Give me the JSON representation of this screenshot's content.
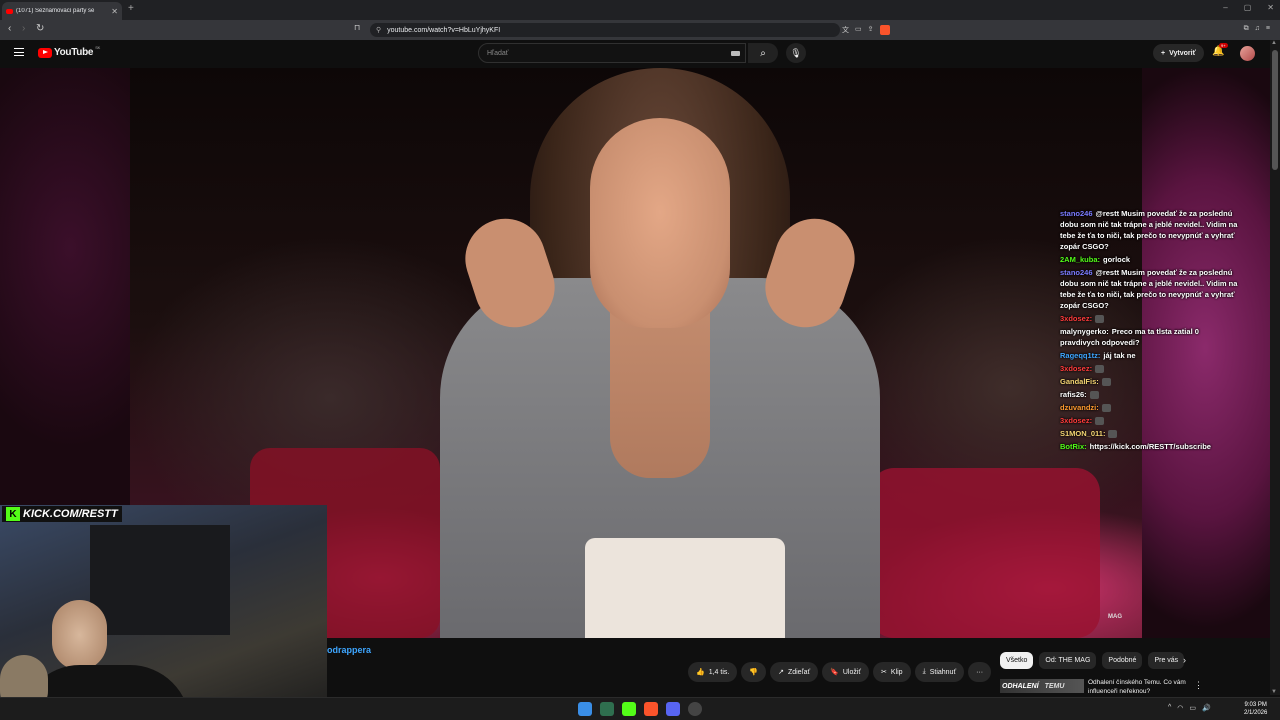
{
  "browser": {
    "tab_title": "(1071) Seznamovací party se",
    "url": "youtube.com/watch?v=HbLuYjhyKFI",
    "new_tab": "+",
    "window_controls": [
      "–",
      "▢",
      "✕"
    ]
  },
  "youtube": {
    "logo_text": "YouTube",
    "country": "SK",
    "search_placeholder": "Hľadať",
    "create_label": "Vytvoriť",
    "notification_count": "9+"
  },
  "overlay": {
    "kick_text": "KICK.COM/RESTT",
    "watermark": "MAG"
  },
  "chat": [
    {
      "user": "stano246",
      "user_color": "#7b7bff",
      "text": "@restt Musim povedať že za poslednú dobu som nič tak trápne a jeblé nevidel.. Vidim na tebe že ťa to niči, tak prečo to nevypnúť a vyhrať zopár CSGO?"
    },
    {
      "user": "2AM_kuba:",
      "user_color": "#53fc18",
      "text": "gorlock"
    },
    {
      "user": "stano246",
      "user_color": "#7b7bff",
      "text": "@restt Musim povedať že za poslednú dobu som nič tak trápne a jeblé nevidel.. Vidim na tebe že ťa to niči, tak prečo to nevypnúť a vyhrať zopár CSGO?"
    },
    {
      "user": "3xdosez:",
      "user_color": "#ff3b3b",
      "text": ""
    },
    {
      "user": "malynygerko:",
      "user_color": "#ffffff",
      "text": "Preco ma ta tlsta zatial 0 pravdivych odpovedi?"
    },
    {
      "user": "Rageqq1tz:",
      "user_color": "#3ea6ff",
      "text": "jáj tak ne"
    },
    {
      "user": "3xdosez:",
      "user_color": "#ff3b3b",
      "text": ""
    },
    {
      "user": "GandalFis:",
      "user_color": "#f7d774",
      "text": ""
    },
    {
      "user": "rafis26:",
      "user_color": "#ffffff",
      "text": ""
    },
    {
      "user": "dzuvandzi:",
      "user_color": "#ff9b2f",
      "text": ""
    },
    {
      "user": "3xdosez:",
      "user_color": "#ff3b3b",
      "text": ""
    },
    {
      "user": "S1MON_011:",
      "user_color": "#f7d774",
      "text": ""
    },
    {
      "user": "BotRix:",
      "user_color": "#53fc18",
      "text": "https://kick.com/RESTT/subscribe"
    }
  ],
  "below_video": {
    "channel_fragment": "odrappera",
    "like_count": "1,4 tis.",
    "share": "Zdieľať",
    "save": "Uložiť",
    "clip": "Klip",
    "download": "Stiahnuť",
    "more": "···"
  },
  "chips": [
    "Všetko",
    "Od: THE MAG",
    "Podobné",
    "Pre vás"
  ],
  "recommendation": {
    "thumb_text_left": "ODHALENÍ",
    "thumb_text_right": "TEMU",
    "title": "Odhalení čínského Temu. Co vám influenceři neřeknou?"
  },
  "taskbar": {
    "time": "9:03 PM",
    "date": "2/1/2026",
    "accent": "#53fc18"
  }
}
